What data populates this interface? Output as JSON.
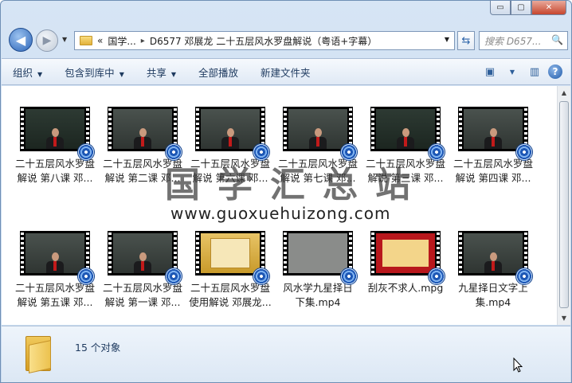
{
  "window": {
    "caption_buttons": {
      "minimize": "▭",
      "maximize": "▢",
      "close": "✕"
    }
  },
  "address_bar": {
    "overflow": "«",
    "segments": [
      "国学...",
      "D6577 邓展龙 二十五层风水罗盘解说（粤语+字幕）"
    ],
    "separator": "▸",
    "search_placeholder": "搜索 D657...",
    "search_icon": "🔍",
    "refresh_icon": "⇆"
  },
  "nav": {
    "back_icon": "◀",
    "forward_icon": "▶",
    "dropdown_icon": "▼"
  },
  "toolbar": {
    "organize": "组织",
    "include_in_library": "包含到库中",
    "share": "共享",
    "play_all": "全部播放",
    "new_folder": "新建文件夹",
    "dropdown_arrow": "▼",
    "views_icon": "▣",
    "preview_pane_icon": "▥",
    "help_icon": "?"
  },
  "files": [
    {
      "line1": "二十五层风水罗盘",
      "line2": "解说 第八课 邓...",
      "thumb": "board-red"
    },
    {
      "line1": "二十五层风水罗盘",
      "line2": "解说 第二课 邓...",
      "thumb": "board-white"
    },
    {
      "line1": "二十五层风水罗盘",
      "line2": "解说 第六课 邓...",
      "thumb": "board-white"
    },
    {
      "line1": "二十五层风水罗盘",
      "line2": "解说 第七课 邓...",
      "thumb": "board-white"
    },
    {
      "line1": "二十五层风水罗盘",
      "line2": "解说 第三课 邓...",
      "thumb": "board-title"
    },
    {
      "line1": "二十五层风水罗盘",
      "line2": "解说 第四课 邓...",
      "thumb": "board-white"
    },
    {
      "line1": "二十五层风水罗盘",
      "line2": "解说 第五课 邓...",
      "thumb": "board-white"
    },
    {
      "line1": "二十五层风水罗盘",
      "line2": "解说 第一课 邓...",
      "thumb": "board-white"
    },
    {
      "line1": "二十五层风水罗盘",
      "line2": "使用解说 邓展龙...",
      "thumb": "certificate"
    },
    {
      "line1": "风水学九星择日",
      "line2": "下集.mp4",
      "thumb": "plain"
    },
    {
      "line1": "刮灰不求人.mpg",
      "line2": "",
      "thumb": "red-certificate"
    },
    {
      "line1": "九星择日文字上",
      "line2": "集.mp4",
      "thumb": "board-white"
    }
  ],
  "watermark": {
    "title": "国学汇总站",
    "url": "www.guoxuehuizong.com"
  },
  "scrollbar": {
    "up": "▲",
    "down": "▼"
  },
  "status": {
    "count": "15 个对象"
  }
}
